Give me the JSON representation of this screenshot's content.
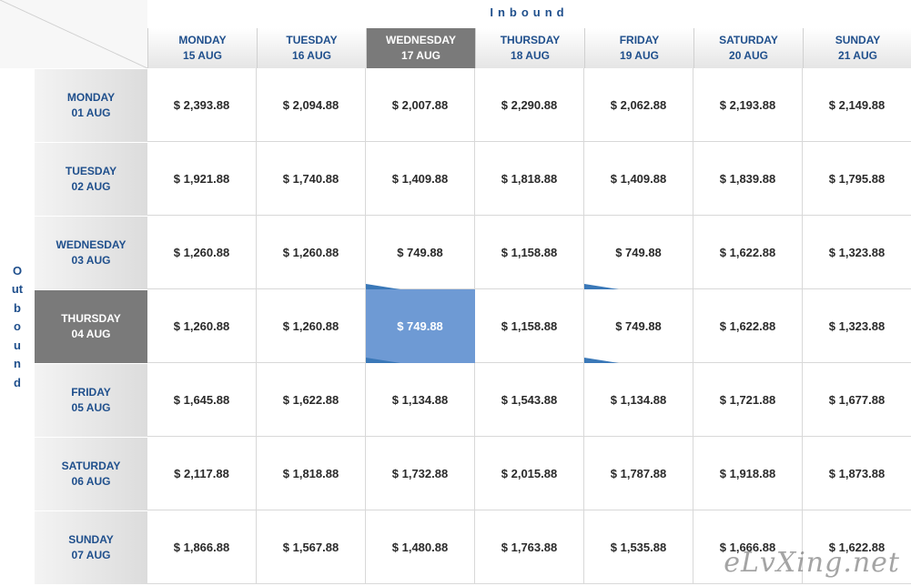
{
  "grid": {
    "inbound_label": "Inbound",
    "outbound_label": "Outbound",
    "columns": [
      {
        "day": "MONDAY",
        "date": "15 AUG"
      },
      {
        "day": "TUESDAY",
        "date": "16 AUG"
      },
      {
        "day": "WEDNESDAY",
        "date": "17 AUG"
      },
      {
        "day": "THURSDAY",
        "date": "18 AUG"
      },
      {
        "day": "FRIDAY",
        "date": "19 AUG"
      },
      {
        "day": "SATURDAY",
        "date": "20 AUG"
      },
      {
        "day": "SUNDAY",
        "date": "21 AUG"
      }
    ],
    "rows": [
      {
        "day": "MONDAY",
        "date": "01 AUG",
        "prices": [
          "$ 2,393.88",
          "$ 2,094.88",
          "$ 2,007.88",
          "$ 2,290.88",
          "$ 2,062.88",
          "$ 2,193.88",
          "$ 2,149.88"
        ]
      },
      {
        "day": "TUESDAY",
        "date": "02 AUG",
        "prices": [
          "$ 1,921.88",
          "$ 1,740.88",
          "$ 1,409.88",
          "$ 1,818.88",
          "$ 1,409.88",
          "$ 1,839.88",
          "$ 1,795.88"
        ]
      },
      {
        "day": "WEDNESDAY",
        "date": "03 AUG",
        "prices": [
          "$ 1,260.88",
          "$ 1,260.88",
          "$ 749.88",
          "$ 1,158.88",
          "$ 749.88",
          "$ 1,622.88",
          "$ 1,323.88"
        ]
      },
      {
        "day": "THURSDAY",
        "date": "04 AUG",
        "prices": [
          "$ 1,260.88",
          "$ 1,260.88",
          "$ 749.88",
          "$ 1,158.88",
          "$ 749.88",
          "$ 1,622.88",
          "$ 1,323.88"
        ]
      },
      {
        "day": "FRIDAY",
        "date": "05 AUG",
        "prices": [
          "$ 1,645.88",
          "$ 1,622.88",
          "$ 1,134.88",
          "$ 1,543.88",
          "$ 1,134.88",
          "$ 1,721.88",
          "$ 1,677.88"
        ]
      },
      {
        "day": "SATURDAY",
        "date": "06 AUG",
        "prices": [
          "$ 2,117.88",
          "$ 1,818.88",
          "$ 1,732.88",
          "$ 2,015.88",
          "$ 1,787.88",
          "$ 1,918.88",
          "$ 1,873.88"
        ]
      },
      {
        "day": "SUNDAY",
        "date": "07 AUG",
        "prices": [
          "$ 1,866.88",
          "$ 1,567.88",
          "$ 1,480.88",
          "$ 1,763.88",
          "$ 1,535.88",
          "$ 1,666.88",
          "$ 1,622.88"
        ]
      }
    ],
    "selected_column": 2,
    "selected_row": 3
  },
  "watermark": "eLvXing.net",
  "colors": {
    "accent": "#1f4f8c",
    "highlight": "#6e9ad4",
    "selected_header": "#7a7a7a",
    "lowest_marker": "#3a78b8"
  }
}
